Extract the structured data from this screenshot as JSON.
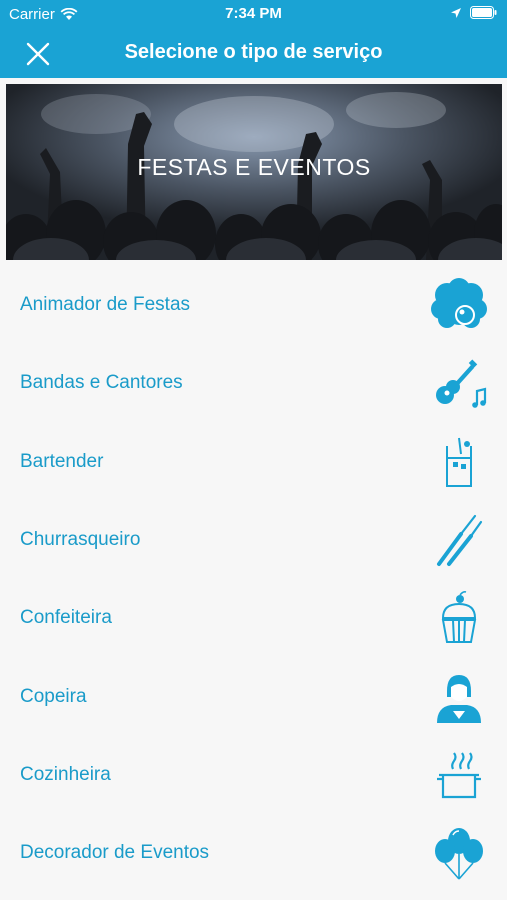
{
  "status_bar": {
    "carrier": "Carrier",
    "time": "7:34 PM"
  },
  "header": {
    "title": "Selecione o tipo de serviço"
  },
  "banner": {
    "label": "FESTAS E EVENTOS"
  },
  "services": [
    {
      "label": "Animador de Festas",
      "icon": "clown-icon"
    },
    {
      "label": "Bandas e Cantores",
      "icon": "guitar-icon"
    },
    {
      "label": "Bartender",
      "icon": "drink-icon"
    },
    {
      "label": "Churrasqueiro",
      "icon": "barbecue-knife-icon"
    },
    {
      "label": "Confeiteira",
      "icon": "cupcake-icon"
    },
    {
      "label": "Copeira",
      "icon": "maid-icon"
    },
    {
      "label": "Cozinheira",
      "icon": "cooking-pot-icon"
    },
    {
      "label": "Decorador de Eventos",
      "icon": "balloons-icon"
    }
  ],
  "colors": {
    "primary": "#1aa3d4",
    "text_accent": "#1a9bc9",
    "background": "#f7f7f7"
  }
}
